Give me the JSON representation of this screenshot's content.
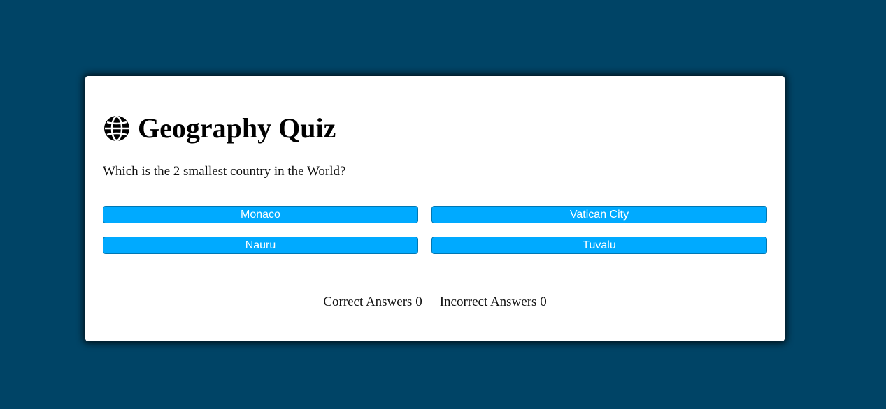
{
  "quiz": {
    "title": "Geography Quiz",
    "title_icon": "globe-icon",
    "question": "Which is the 2 smallest country in the World?",
    "answers": [
      {
        "label": "Monaco"
      },
      {
        "label": "Vatican City"
      },
      {
        "label": "Nauru"
      },
      {
        "label": "Tuvalu"
      }
    ],
    "score": {
      "correct_label": "Correct Answers",
      "correct_value": "0",
      "incorrect_label": "Incorrect Answers",
      "incorrect_value": "0"
    }
  },
  "colors": {
    "background": "#004466",
    "card": "#ffffff",
    "button": "#00aaff",
    "button_text": "#ffffff"
  }
}
